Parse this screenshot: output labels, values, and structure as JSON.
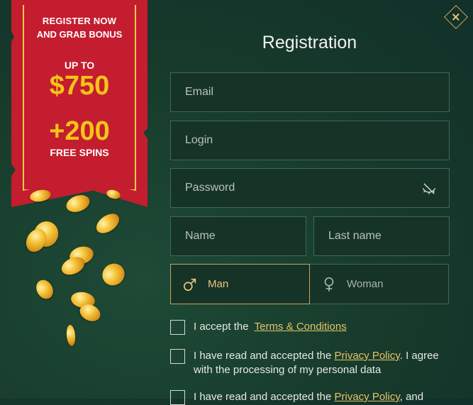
{
  "promo": {
    "line1": "REGISTER NOW",
    "line2": "AND GRAB BONUS",
    "upto": "UP TO",
    "amount": "$750",
    "spins": "+200",
    "free": "FREE SPINS"
  },
  "form": {
    "title": "Registration",
    "email_placeholder": "Email",
    "login_placeholder": "Login",
    "password_placeholder": "Password",
    "name_placeholder": "Name",
    "lastname_placeholder": "Last name",
    "gender_man": "Man",
    "gender_woman": "Woman",
    "selected_gender": "Man"
  },
  "checkboxes": {
    "terms_prefix": "I accept the",
    "terms_link": "Terms & Conditions",
    "privacy_prefix": "I have read and accepted the",
    "privacy_link": "Privacy Policy",
    "privacy_suffix": ". I agree with the processing of my personal data",
    "privacy2_prefix": "I have read and accepted the",
    "privacy2_link": "Privacy Policy",
    "privacy2_suffix": ", and"
  },
  "icons": {
    "close": "close-icon",
    "eye": "eye-slash-icon",
    "male": "male-icon",
    "female": "female-icon"
  },
  "colors": {
    "background": "#173a2b",
    "banner": "#c41d2f",
    "accent_gold": "#e7c36b",
    "bonus_yellow": "#f5c518"
  }
}
